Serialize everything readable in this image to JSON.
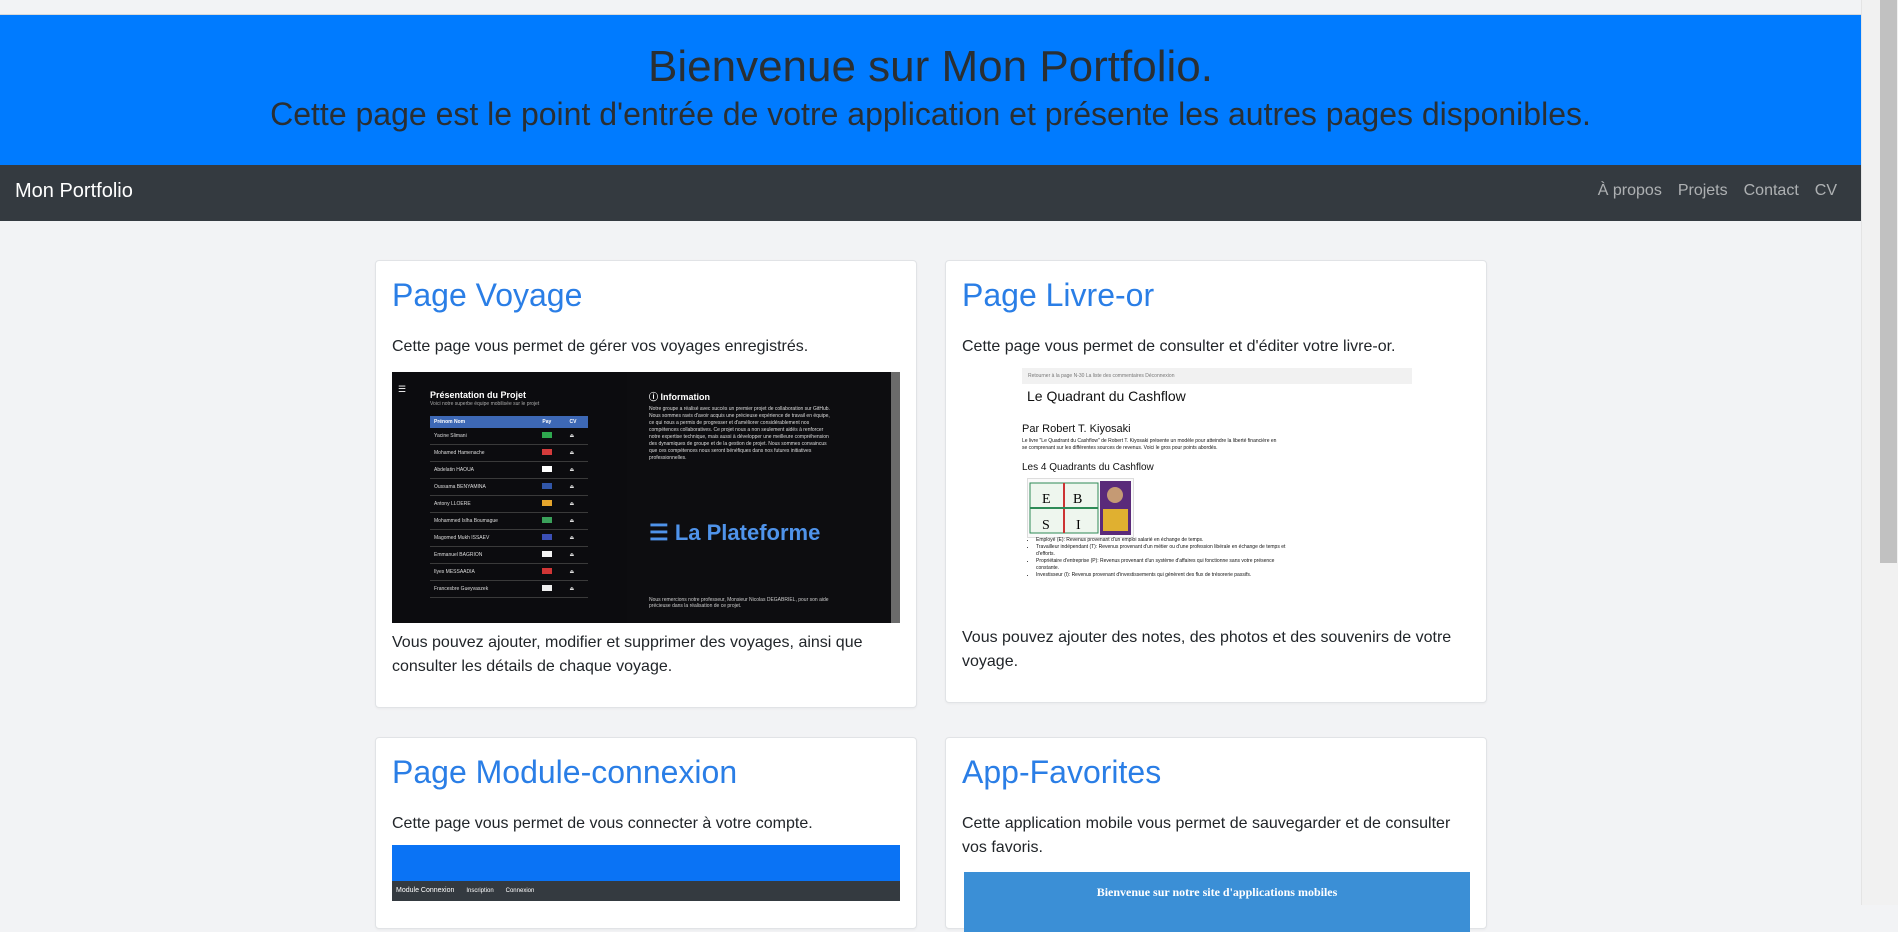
{
  "hero": {
    "title": "Bienvenue sur Mon Portfolio.",
    "subtitle": "Cette page est le point d'entrée de votre application et présente les autres pages disponibles."
  },
  "navbar": {
    "brand": "Mon Portfolio",
    "links": [
      "À propos",
      "Projets",
      "Contact",
      "CV"
    ]
  },
  "cards": [
    {
      "title": "Page Voyage",
      "desc": "Cette page vous permet de gérer vos voyages enregistrés.",
      "footer": "Vous pouvez ajouter, modifier et supprimer des voyages, ainsi que consulter les détails de chaque voyage.",
      "preview": {
        "title": "Présentation du Projet",
        "subtitle": "Voici notre superbe équipe mobilisée sur le projet",
        "headers": [
          "Prénom Nom",
          "Pay",
          "CV"
        ],
        "rows": [
          {
            "name": "Yacine Slimani",
            "flag": "#2fa84f"
          },
          {
            "name": "Mohamed Hamenache",
            "flag": "#d43b3b"
          },
          {
            "name": "Abdelatin HAOUA",
            "flag": "#ffffff"
          },
          {
            "name": "Oussama BENYAMINA",
            "flag": "#3156a8"
          },
          {
            "name": "Antony LLOERE",
            "flag": "#e5a52c"
          },
          {
            "name": "Mohammed Islha Boumague",
            "flag": "#3aa05a"
          },
          {
            "name": "Magomed Mukh ISSAEV",
            "flag": "#3b4fb5"
          },
          {
            "name": "Emmanuel BAGRION",
            "flag": "#f3f3f3"
          },
          {
            "name": "Ilyes MESSAADIA",
            "flag": "#d03535"
          },
          {
            "name": "Francesbre Gueyvaszek",
            "flag": "#eeeeee"
          }
        ],
        "info_title": "Information",
        "info_text": "Notre groupe a réalisé avec succès un premier projet de collaboration sur GitHub. Nous sommes ravis d'avoir acquis une précieuse expérience de travail en équipe, ce qui nous a permis de progresser et d'améliorer considérablement nos compétences collaboratives. Ce projet nous a non seulement aidés à renforcer notre expertise technique, mais aussi à développer une meilleure compréhension des dynamiques de groupe et de la gestion de projet. Nous sommes convaincus que ces compétences nous seront bénéfiques dans nos futures initiatives professionnelles.",
        "brand": "La Plateforme",
        "footer_text": "Nous remercions notre professeur, Monsieur Nicolas DEGABRIEL, pour son aide précieuse dans la réalisation de ce projet."
      }
    },
    {
      "title": "Page Livre-or",
      "desc": "Cette page vous permet de consulter et d'éditer votre livre-or.",
      "footer": "Vous pouvez ajouter des notes, des photos et des souvenirs de votre voyage.",
      "preview": {
        "nav": "Retourner à la page N-30    La liste des commentaires    Déconnexion",
        "title": "Le Quadrant du Cashflow",
        "author": "Par Robert T. Kiyosaki",
        "intro": "Le livre \"Le Quadrant du Cashflow\" de Robert T. Kiyosaki présente un modèle pour atteindre la liberté financière en se comprenant sur les différentes sources de revenus. Voici le gros pour points abordés.",
        "section": "Les 4 Quadrants du Cashflow",
        "list": [
          "Employé (E): Revenus provenant d'un emploi salarié en échange de temps.",
          "Travailleur indépendant (T): Revenus provenant d'un métier ou d'une profession libérale en échange de temps et d'efforts.",
          "Propriétaire d'entreprise (P): Revenus provenant d'un système d'affaires qui fonctionne sans votre présence constante.",
          "Investisseur (I): Revenus provenant d'investissements qui génèrent des flux de trésorerie passifs."
        ]
      }
    },
    {
      "title": "Page Module-connexion",
      "desc": "Cette page vous permet de vous connecter à votre compte.",
      "preview": {
        "brand": "Module Connexion",
        "links": [
          "Inscription",
          "Connexion"
        ]
      }
    },
    {
      "title": "App-Favorites",
      "desc": "Cette application mobile vous permet de sauvegarder et de consulter vos favoris.",
      "preview": {
        "banner": "Bienvenue sur notre site d'applications mobiles"
      }
    }
  ]
}
